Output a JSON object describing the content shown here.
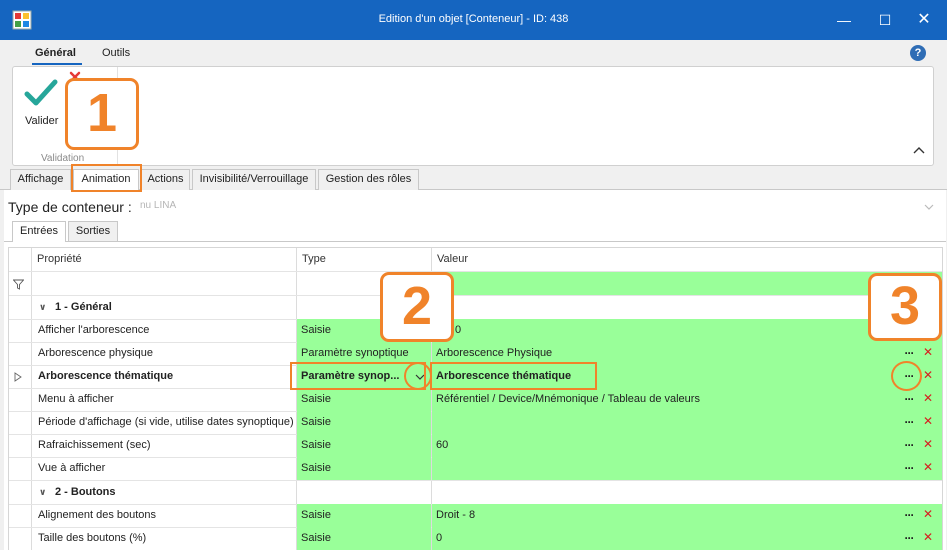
{
  "window": {
    "title": "Edition d'un objet [Conteneur] - ID: 438",
    "minimize": "—",
    "maximize": "☐",
    "close": "✕"
  },
  "ribbon": {
    "tabs": [
      "Général",
      "Outils"
    ],
    "valider_label": "Valider",
    "group_label": "Validation",
    "help": "?"
  },
  "main_tabs": [
    "Affichage",
    "Animation",
    "Actions",
    "Invisibilité/Verrouillage",
    "Gestion des rôles"
  ],
  "active_main_tab": "Animation",
  "type_conteneur": {
    "label": "Type de conteneur :",
    "value": "nu LINA"
  },
  "sub_tabs": [
    "Entrées",
    "Sorties"
  ],
  "grid": {
    "headers": [
      "Propriété",
      "Type",
      "Valeur"
    ],
    "groups": [
      {
        "label": "1 - Général",
        "rows": [
          {
            "property": "Afficher l'arborescence",
            "type": "Saisie",
            "value": "... - 0"
          },
          {
            "property": "Arborescence physique",
            "type": "Paramètre synoptique",
            "value": "Arborescence Physique"
          },
          {
            "property": "Arborescence thématique",
            "type": "Paramètre synop...",
            "value": "Arborescence thématique"
          },
          {
            "property": "Menu à afficher",
            "type": "Saisie",
            "value": "Référentiel / Device/Mnémonique / Tableau de valeurs"
          },
          {
            "property": "Période d'affichage (si vide, utilise dates synoptique)",
            "type": "Saisie",
            "value": ""
          },
          {
            "property": "Rafraichissement (sec)",
            "type": "Saisie",
            "value": "60"
          },
          {
            "property": "Vue à afficher",
            "type": "Saisie",
            "value": ""
          }
        ]
      },
      {
        "label": "2 - Boutons",
        "rows": [
          {
            "property": "Alignement des boutons",
            "type": "Saisie",
            "value": "Droit - 8"
          },
          {
            "property": "Taille des boutons (%)",
            "type": "Saisie",
            "value": "0"
          }
        ]
      }
    ]
  },
  "annotations": [
    "1",
    "2",
    "3"
  ],
  "colors": {
    "titlebar": "#1565c0",
    "grid_green": "#99ff99",
    "annotation_orange": "#f0832a",
    "delete_red": "#d62020",
    "check_green": "#26a69a"
  }
}
